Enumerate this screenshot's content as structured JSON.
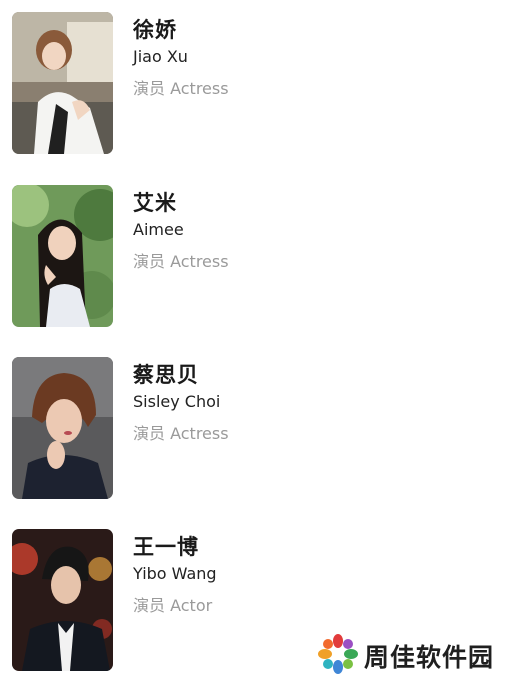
{
  "cast": [
    {
      "name_cn": "徐娇",
      "name_en": "Jiao Xu",
      "role": "演员 Actress"
    },
    {
      "name_cn": "艾米",
      "name_en": "Aimee",
      "role": "演员 Actress"
    },
    {
      "name_cn": "蔡思贝",
      "name_en": "Sisley Choi",
      "role": "演员 Actress"
    },
    {
      "name_cn": "王一博",
      "name_en": "Yibo Wang",
      "role": "演员 Actor"
    }
  ],
  "watermark": {
    "text": "周佳软件园"
  }
}
